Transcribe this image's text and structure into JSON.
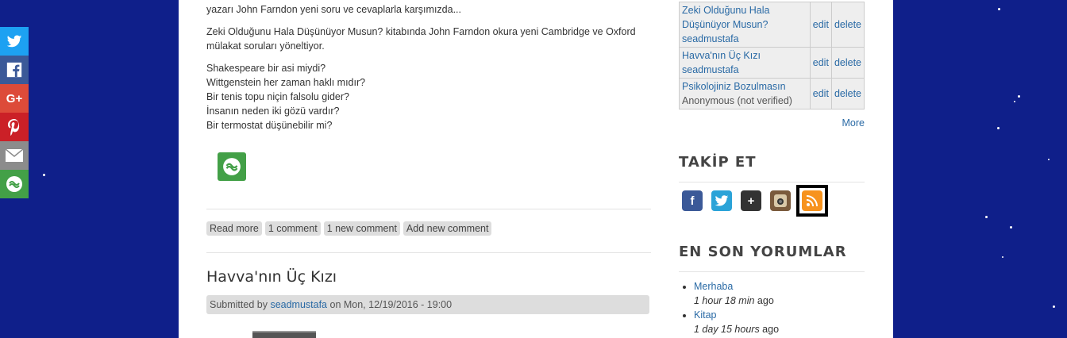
{
  "share": {
    "icons": [
      "twitter-icon",
      "facebook-icon",
      "google-plus-icon",
      "pinterest-icon",
      "email-icon",
      "share-more-icon"
    ]
  },
  "article1": {
    "line_top": "yazarı John Farndon yeni soru ve cevaplarla karşımızda...",
    "para2": "Zeki Olduğunu Hala Düşünüyor Musun? kitabında John Farndon okura yeni Cambridge ve Oxford mülakat soruları yöneltiyor.",
    "questions": [
      "Shakespeare bir asi miydi?",
      "Wittgenstein her zaman haklı mıdır?",
      "Bir tenis topu niçin falsolu gider?",
      "İnsanın neden iki gözü vardır?",
      "Bir termostat düşünebilir mi?"
    ],
    "links": [
      "Read more",
      "1 comment",
      "1 new comment",
      "Add new comment"
    ]
  },
  "article2": {
    "title": "Havva'nın Üç Kızı",
    "submitted_prefix": "Submitted by ",
    "author": "seadmustafa",
    "submitted_suffix": " on Mon, 12/19/2016 - 19:00"
  },
  "recent_table": {
    "rows": [
      {
        "title": "Zeki Olduğunu Hala Düşünüyor Musun?",
        "author": "seadmustafa",
        "author_link": true,
        "edit": "edit",
        "delete": "delete"
      },
      {
        "title": "Havva'nın Üç Kızı",
        "author": "seadmustafa",
        "author_link": true,
        "edit": "edit",
        "delete": "delete"
      },
      {
        "title": "Psikolojiniz Bozulmasın",
        "author": "Anonymous (not verified)",
        "author_link": false,
        "edit": "edit",
        "delete": "delete"
      }
    ],
    "more": "More"
  },
  "follow": {
    "heading": "TAKİP ET",
    "icons": [
      "facebook-icon",
      "twitter-icon",
      "google-plus-icon",
      "instagram-icon",
      "rss-icon"
    ]
  },
  "comments": {
    "heading": "EN SON YORUMLAR",
    "items": [
      {
        "title": "Merhaba",
        "time": "1 hour 18 min",
        "suffix": " ago"
      },
      {
        "title": "Kitap",
        "time": "1 day 15 hours",
        "suffix": " ago"
      }
    ]
  },
  "colors": {
    "background": "#0f1f8a",
    "twitter": "#1da1f2",
    "facebook": "#3b5998",
    "google": "#dd4b39",
    "pinterest": "#cb2027",
    "email": "#8c8c8c",
    "share": "#43a047",
    "rss": "#f7931e"
  }
}
